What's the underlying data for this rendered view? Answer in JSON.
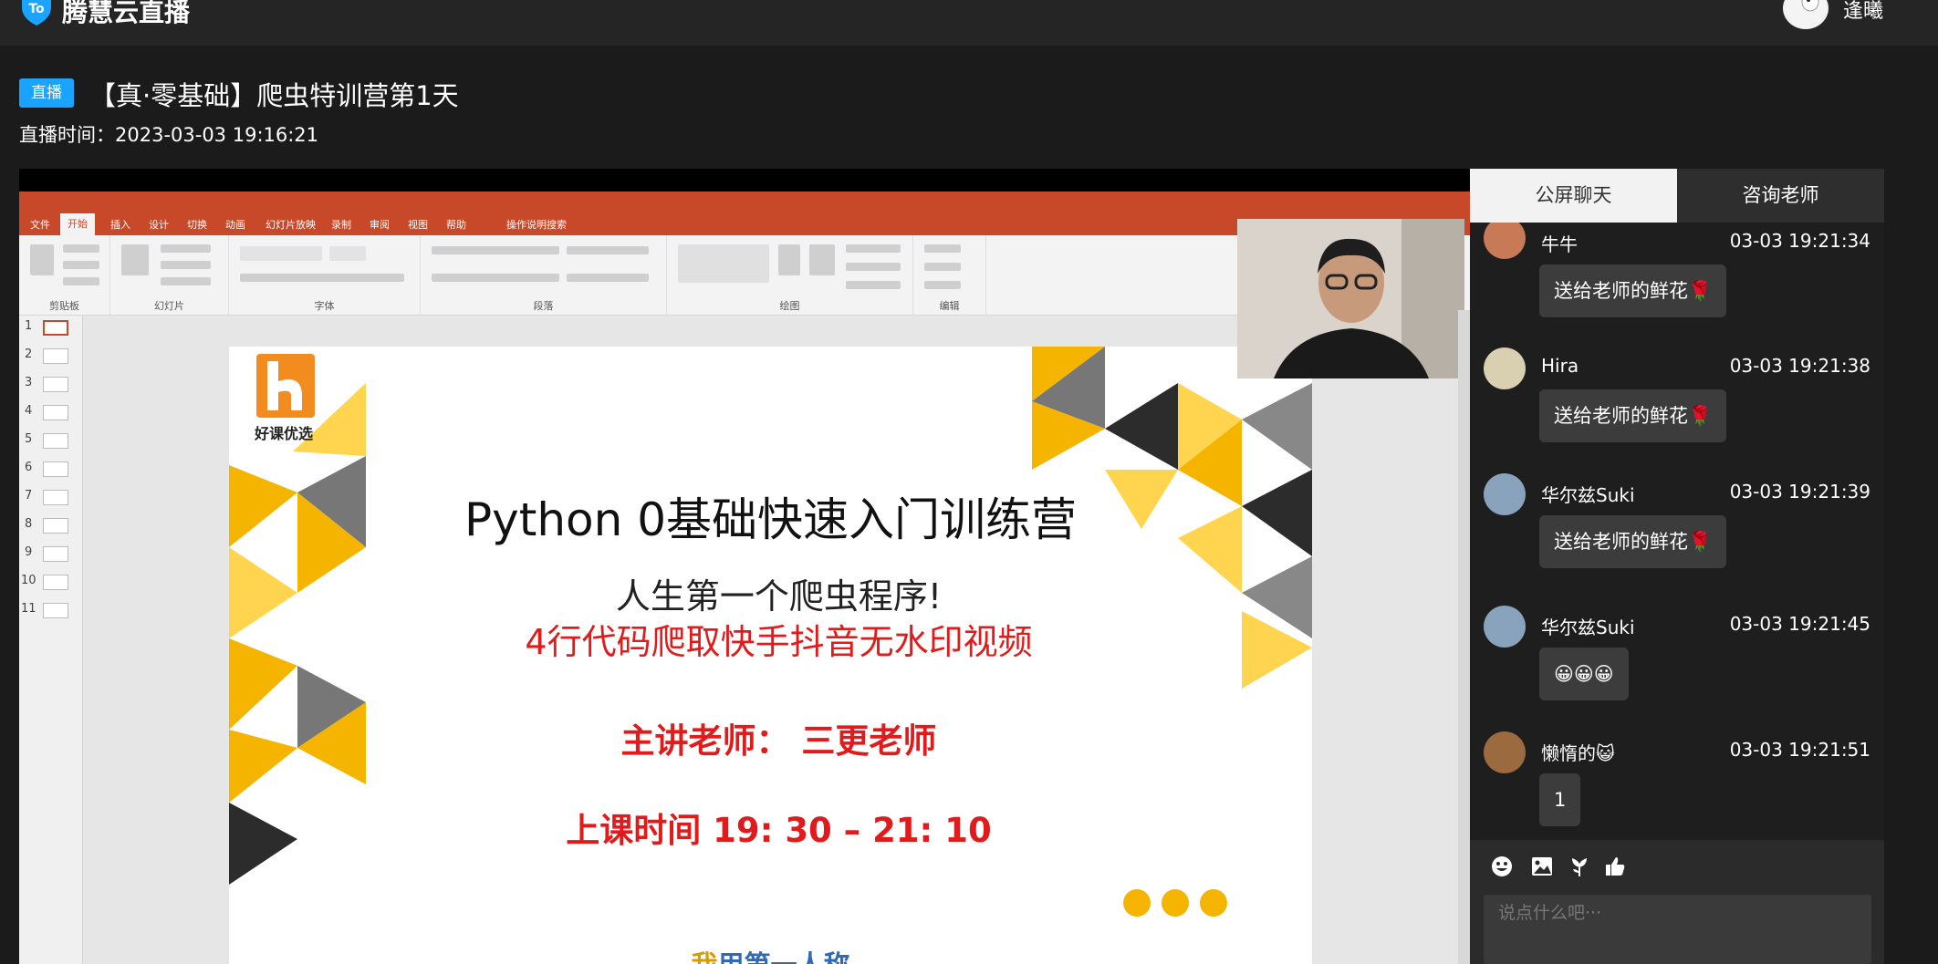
{
  "header": {
    "brand": "腾慧云直播",
    "username": "逢曦"
  },
  "live": {
    "badge": "直播",
    "title": "【真·零基础】爬虫特训营第1天",
    "time_label": "直播时间：",
    "time_value": "2023-03-03 19:16:21"
  },
  "ppt": {
    "menu": [
      "文件",
      "开始",
      "插入",
      "设计",
      "切换",
      "动画",
      "幻灯片放映",
      "录制",
      "审阅",
      "视图",
      "帮助",
      "操作说明搜索"
    ],
    "active_menu": "开始",
    "groups": [
      "剪贴板",
      "幻灯片",
      "字体",
      "段落",
      "绘图",
      "编辑"
    ],
    "thumb_numbers": [
      "1",
      "2",
      "3",
      "4",
      "5",
      "6",
      "7",
      "8",
      "9",
      "10",
      "11"
    ]
  },
  "slide": {
    "logo_text": "好课优选",
    "title": "Python 0基础快速入门训练营",
    "subtitle1": "人生第一个爬虫程序!",
    "subtitle2": "4行代码爬取快手抖音无水印视频",
    "teacher": "主讲老师：  三更老师",
    "time": "上课时间 19: 30  –  21: 10",
    "caption_highlight": "我",
    "caption_rest": "用第一人称"
  },
  "chat": {
    "tab_public": "公屏聊天",
    "tab_teacher": "咨询老师",
    "messages": [
      {
        "name": "牛牛",
        "time": "03-03 19:21:34",
        "text": "送给老师的鲜花🌹"
      },
      {
        "name": "Hira",
        "time": "03-03 19:21:38",
        "text": "送给老师的鲜花🌹"
      },
      {
        "name": "华尔兹Suki",
        "time": "03-03 19:21:39",
        "text": "送给老师的鲜花🌹"
      },
      {
        "name": "华尔兹Suki",
        "time": "03-03 19:21:45",
        "text": "😀😀😀"
      },
      {
        "name": "懒惰的😺",
        "time": "03-03 19:21:51",
        "text": "1"
      }
    ],
    "input_placeholder": "说点什么吧···"
  },
  "icons": [
    "logo-icon",
    "emoji-icon",
    "image-icon",
    "flower-icon",
    "thumbs-up-icon"
  ],
  "colors": {
    "badge": "#1aa3ff",
    "ppt_accent": "#c8482a",
    "slide_red": "#e11b1b",
    "slide_yellow": "#f4b400"
  }
}
